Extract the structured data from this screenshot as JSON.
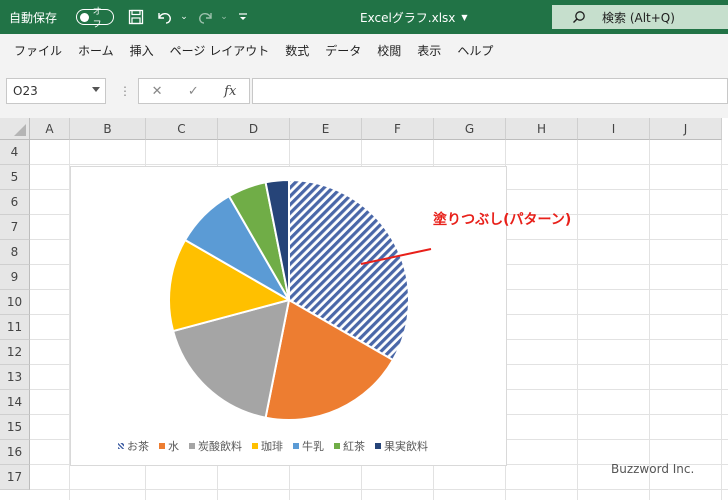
{
  "titlebar": {
    "autosave_label": "自動保存",
    "autosave_state": "オフ",
    "filename": "Excelグラフ.xlsx",
    "search_label": "検索 (Alt+Q)"
  },
  "menu": [
    "ファイル",
    "ホーム",
    "挿入",
    "ページ レイアウト",
    "数式",
    "データ",
    "校閲",
    "表示",
    "ヘルプ"
  ],
  "formula": {
    "namebox": "O23",
    "fx": "fx",
    "cancel": "✕",
    "confirm": "✓"
  },
  "columns": [
    "A",
    "B",
    "C",
    "D",
    "E",
    "F",
    "G",
    "H",
    "I",
    "J"
  ],
  "rows": [
    "4",
    "5",
    "6",
    "7",
    "8",
    "9",
    "10",
    "11",
    "12",
    "13",
    "14",
    "15",
    "16",
    "17"
  ],
  "chart_data": {
    "type": "pie",
    "categories": [
      "お茶",
      "水",
      "炭酸飲料",
      "珈琲",
      "牛乳",
      "紅茶",
      "果実飲料"
    ],
    "values": [
      32,
      19,
      17,
      12,
      8,
      5,
      3
    ],
    "colors": [
      "#4472c4",
      "#ed7d31",
      "#a5a5a5",
      "#ffc000",
      "#5b9bd5",
      "#70ad47",
      "#264478"
    ],
    "legend": "bottom",
    "pattern_on_first_slice": true
  },
  "annotation": "塗りつぶし(パターン)",
  "watermark": "Buzzword Inc.",
  "colors": {
    "title_bar": "#217346",
    "annotation": "#e8201a"
  }
}
